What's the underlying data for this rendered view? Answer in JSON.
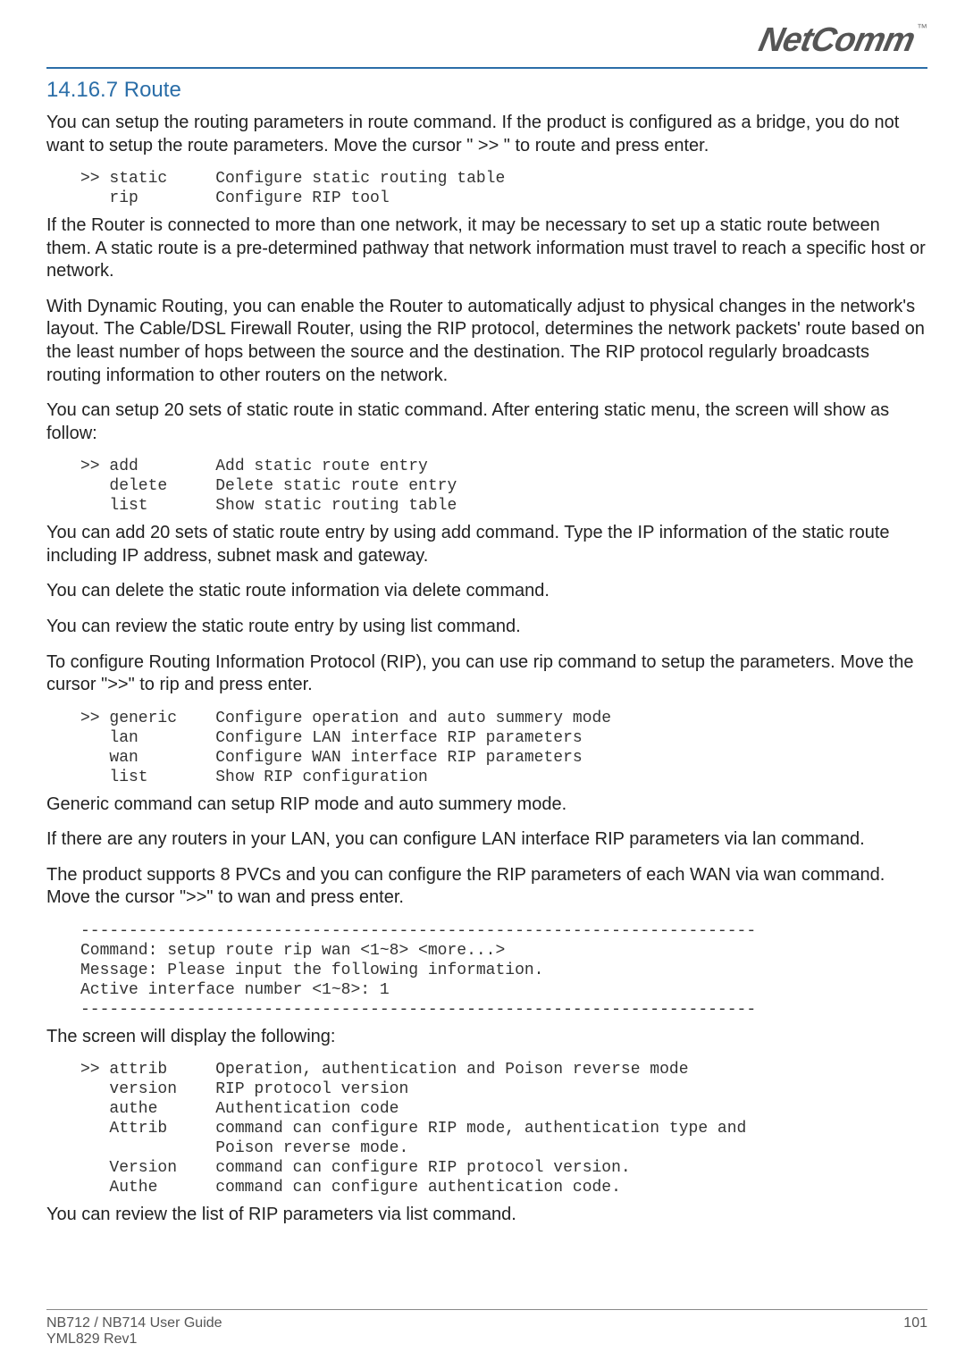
{
  "logo": {
    "text": "NetComm",
    "tm": "™"
  },
  "section_title": "14.16.7 Route",
  "paragraphs": {
    "p1": "You can setup the routing parameters in route command. If the product is configured as a bridge, you do not want to setup the route parameters. Move the cursor \" >> \" to route and press enter.",
    "p2": "If the Router is connected to more than one network, it may be necessary to set up a static route between them. A static route is a pre-determined pathway that network information must travel to reach a specific host or network.",
    "p3": "With Dynamic Routing, you can enable the Router to automatically adjust to physical changes in the network's layout. The Cable/DSL Firewall Router, using the RIP protocol, determines the network packets' route based on the least number of hops between the source and the destination. The RIP protocol regularly broadcasts routing information to other routers on the network.",
    "p4": "You can setup 20 sets of static route in static command. After entering static menu, the screen will show as follow:",
    "p5": "You can add 20 sets of static route entry by using add command. Type the IP information of the static route including IP address, subnet mask and gateway.",
    "p6": "You can delete the static route information via delete command.",
    "p7": "You can review the static route entry by using list command.",
    "p8": "To configure Routing Information Protocol (RIP), you can use rip command to setup the parameters. Move the cursor \">>\" to rip and press enter.",
    "p9": "Generic command can setup RIP mode and auto summery mode.",
    "p10": "If there are any routers in your LAN, you can configure LAN interface RIP parameters via lan command.",
    "p11": "The product supports 8 PVCs and you can configure the RIP parameters of each WAN via wan command. Move the cursor \">>\" to wan and press enter.",
    "p12": "The screen will display the following:",
    "p13": "You can review the list of RIP parameters via list command."
  },
  "codes": {
    "c1": ">> static     Configure static routing table\n   rip        Configure RIP tool",
    "c2": ">> add        Add static route entry\n   delete     Delete static route entry\n   list       Show static routing table",
    "c3": ">> generic    Configure operation and auto summery mode\n   lan        Configure LAN interface RIP parameters\n   wan        Configure WAN interface RIP parameters\n   list       Show RIP configuration",
    "c4": "----------------------------------------------------------------------\nCommand: setup route rip wan <1~8> <more...>\nMessage: Please input the following information.\nActive interface number <1~8>: 1\n----------------------------------------------------------------------",
    "c5": ">> attrib     Operation, authentication and Poison reverse mode\n   version    RIP protocol version\n   authe      Authentication code\n   Attrib     command can configure RIP mode, authentication type and\n              Poison reverse mode.\n   Version    command can configure RIP protocol version.\n   Authe      command can configure authentication code."
  },
  "footer": {
    "line1": "NB712 / NB714 User Guide",
    "line2": "YML829 Rev1",
    "page": "101"
  }
}
